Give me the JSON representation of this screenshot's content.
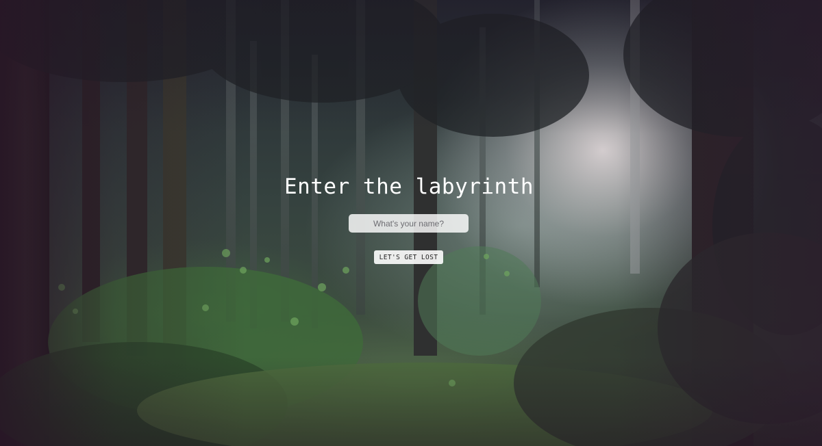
{
  "page": {
    "title": "Enter the labyrinth"
  },
  "form": {
    "name_placeholder": "What's your name?",
    "name_value": "",
    "submit_label": "LET'S GET LOST"
  },
  "colors": {
    "title_text": "#ffffff",
    "input_background": "#ffffff",
    "button_background": "#fafafa"
  }
}
